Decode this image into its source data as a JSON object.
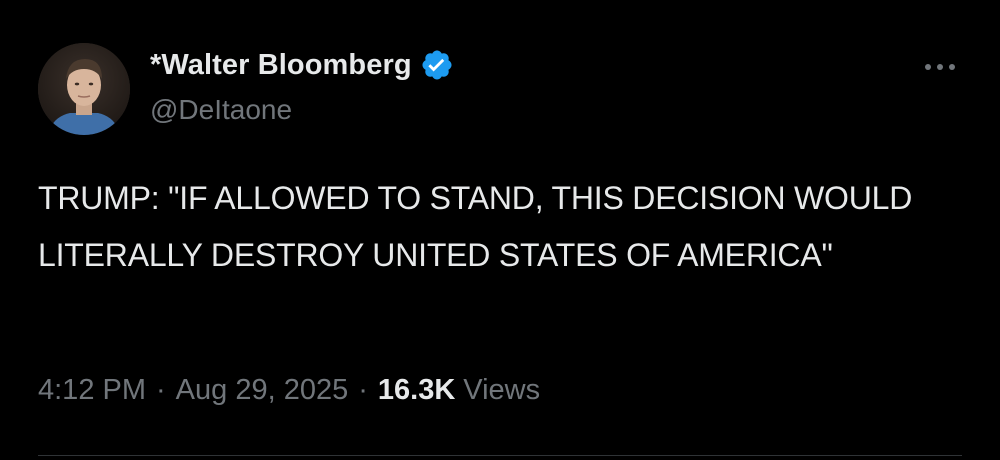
{
  "author": {
    "display_name": "*Walter Bloomberg",
    "handle": "@DeItaone",
    "verified": true,
    "avatar_icon": "profile-photo"
  },
  "tweet": {
    "text": "TRUMP: \"IF ALLOWED TO STAND, THIS DECISION WOULD LITERALLY DESTROY UNITED STATES OF AMERICA\"",
    "time": "4:12 PM",
    "separator": "·",
    "date": "Aug 29, 2025",
    "views_count": "16.3K",
    "views_label": "Views"
  },
  "icons": {
    "verified": "verified-badge-icon",
    "more": "more-options-icon"
  },
  "colors": {
    "background": "#000000",
    "primary_text": "#e7e9ea",
    "secondary_text": "#71767b",
    "verified_blue": "#1d9bf0"
  }
}
